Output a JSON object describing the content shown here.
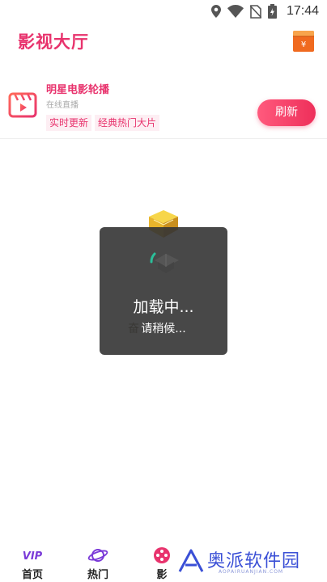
{
  "status_bar": {
    "time": "17:44",
    "icons": [
      "location-icon",
      "wifi-icon",
      "no-sim-icon",
      "battery-charging-icon"
    ]
  },
  "header": {
    "title": "影视大厅",
    "wallet_icon": "red-envelope-icon"
  },
  "banner": {
    "title": "明星电影轮播",
    "subtitle": "在线直播",
    "tags": [
      "实时更新",
      "经典热门大片"
    ],
    "refresh_label": "刷新",
    "icon": "film-play-icon"
  },
  "loading": {
    "title": "加载中...",
    "message": "请稍候..."
  },
  "background_text": "奋",
  "bottom_nav": {
    "items": [
      {
        "label": "首页",
        "icon": "vip-icon"
      },
      {
        "label": "热门",
        "icon": "planet-icon"
      },
      {
        "label": "影",
        "icon": "film-reel-icon"
      }
    ]
  },
  "watermark": {
    "text": "奥派软件园",
    "url": "AOPAIRUANJIAN.COM"
  },
  "colors": {
    "accent": "#e8336d",
    "button_gradient_start": "#ff5a7d",
    "button_gradient_end": "#ee2f5a",
    "dialog_bg": "#343434",
    "watermark": "#3a4fd6"
  }
}
